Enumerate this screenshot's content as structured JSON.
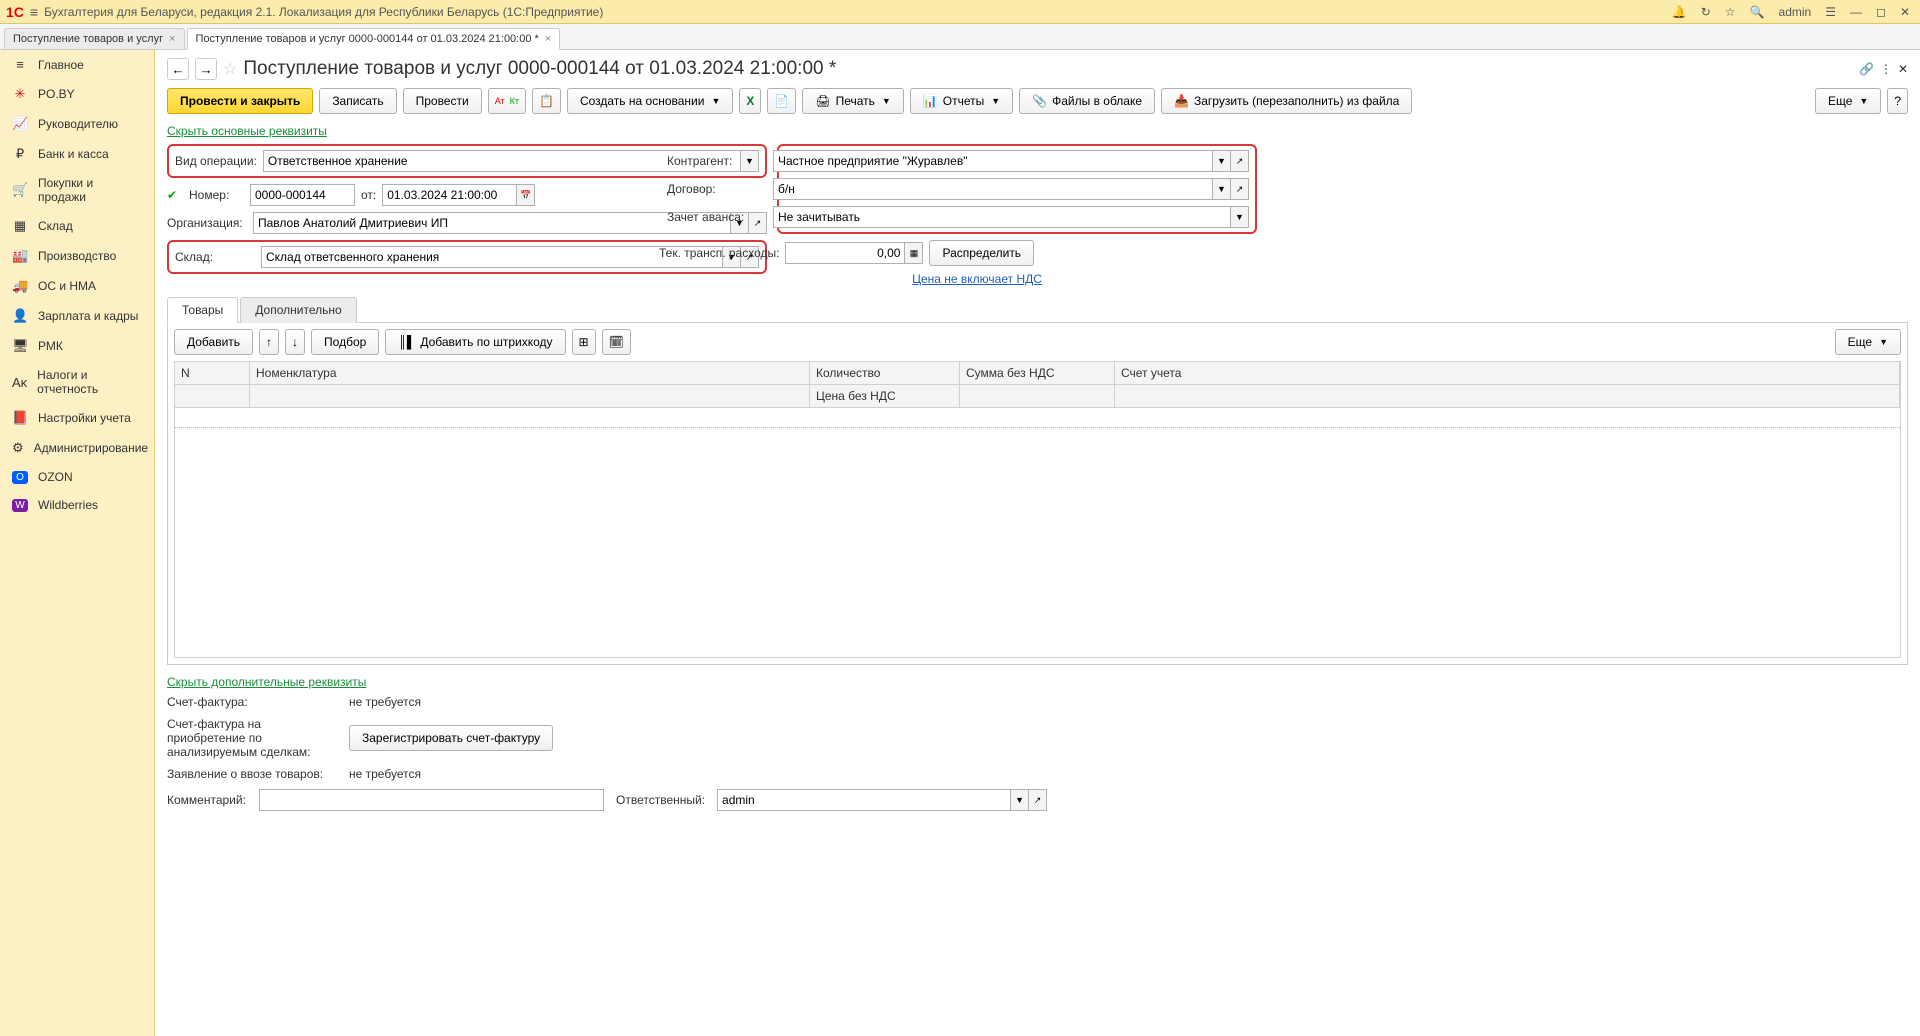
{
  "topbar": {
    "logo": "1С",
    "title": "Бухгалтерия для Беларуси, редакция 2.1. Локализация для Республики Беларусь   (1С:Предприятие)",
    "user": "admin"
  },
  "tabs": [
    {
      "label": "Поступление товаров и услуг",
      "active": false
    },
    {
      "label": "Поступление товаров и услуг 0000-000144 от 01.03.2024 21:00:00 *",
      "active": true
    }
  ],
  "sidebar": {
    "items": [
      {
        "icon": "≡",
        "label": "Главное",
        "color": "#888"
      },
      {
        "icon": "✳",
        "label": "PO.BY",
        "color": "#e30613"
      },
      {
        "icon": "📈",
        "label": "Руководителю",
        "color": "#888"
      },
      {
        "icon": "₽",
        "label": "Банк и касса",
        "color": "#888"
      },
      {
        "icon": "🛒",
        "label": "Покупки и продажи",
        "color": "#888"
      },
      {
        "icon": "▦",
        "label": "Склад",
        "color": "#888"
      },
      {
        "icon": "🏭",
        "label": "Производство",
        "color": "#888"
      },
      {
        "icon": "🚚",
        "label": "ОС и НМА",
        "color": "#888"
      },
      {
        "icon": "👤",
        "label": "Зарплата и кадры",
        "color": "#888"
      },
      {
        "icon": "🖥",
        "label": "РМК",
        "color": "#888"
      },
      {
        "icon": "Аᴋ",
        "label": "Налоги и отчетность",
        "color": "#888"
      },
      {
        "icon": "📕",
        "label": "Настройки учета",
        "color": "#888"
      },
      {
        "icon": "⚙",
        "label": "Администрирование",
        "color": "#888"
      },
      {
        "icon": "O",
        "label": "OZON",
        "color": "#0af"
      },
      {
        "icon": "W",
        "label": "Wildberries",
        "color": "#a0f"
      }
    ]
  },
  "page": {
    "title": "Поступление товаров и услуг 0000-000144 от 01.03.2024 21:00:00 *"
  },
  "toolbar": {
    "post_close": "Провести и закрыть",
    "write": "Записать",
    "post": "Провести",
    "create_based": "Создать на основании",
    "print": "Печать",
    "reports": "Отчеты",
    "files_cloud": "Файлы в облаке",
    "load_file": "Загрузить (перезаполнить) из файла",
    "more": "Еще"
  },
  "form": {
    "hide_main": "Скрыть основные реквизиты",
    "operation_type_lbl": "Вид операции:",
    "operation_type": "Ответственное хранение",
    "number_lbl": "Номер:",
    "number": "0000-000144",
    "from_lbl": "от:",
    "date": "01.03.2024 21:00:00",
    "org_lbl": "Организация:",
    "org": "Павлов Анатолий Дмитриевич ИП",
    "warehouse_lbl": "Склад:",
    "warehouse": "Склад ответсвенного хранения",
    "counterparty_lbl": "Контрагент:",
    "counterparty": "Частное предприятие \"Журавлев\"",
    "contract_lbl": "Договор:",
    "contract": "б/н",
    "advance_lbl": "Зачет аванса:",
    "advance": "Не зачитывать",
    "transport_lbl": "Тек. трансп. расходы:",
    "transport_val": "0,00",
    "distribute": "Распределить",
    "vat_note": "Цена не включает НДС"
  },
  "tabs2": {
    "goods": "Товары",
    "additional": "Дополнительно"
  },
  "gridtools": {
    "add": "Добавить",
    "pick": "Подбор",
    "barcode": "Добавить по штрихкоду",
    "more": "Еще"
  },
  "grid": {
    "col_n": "N",
    "col_nom": "Номенклатура",
    "col_qty": "Количество",
    "col_sum": "Сумма без НДС",
    "col_acct": "Счет учета",
    "col_price": "Цена без НДС"
  },
  "footer": {
    "hide_extra": "Скрыть дополнительные реквизиты",
    "invoice_lbl": "Счет-фактура:",
    "invoice_val": "не требуется",
    "invoice2_lbl": "Счет-фактура на приобретение по анализируемым сделкам:",
    "reg_invoice": "Зарегистрировать счет-фактуру",
    "import_lbl": "Заявление о ввозе товаров:",
    "import_val": "не требуется",
    "comment_lbl": "Комментарий:",
    "responsible_lbl": "Ответственный:",
    "responsible": "admin"
  }
}
